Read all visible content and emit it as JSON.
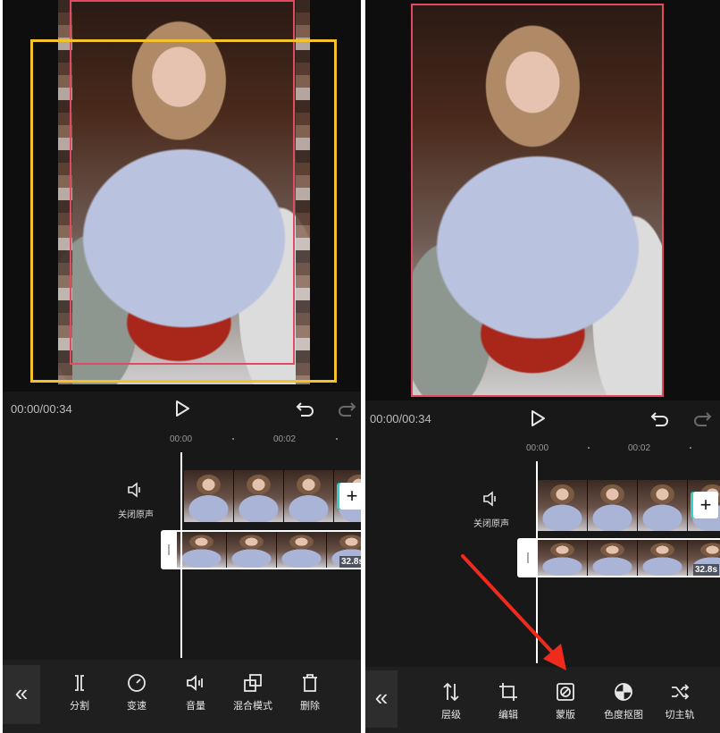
{
  "left": {
    "time": "00:00/00:34",
    "ruler": [
      "00:00",
      "00:02"
    ],
    "mute_label": "关闭原声",
    "duration": "32.8s",
    "tools": [
      {
        "icon": "split-icon",
        "label": "分割"
      },
      {
        "icon": "speed-icon",
        "label": "变速"
      },
      {
        "icon": "volume-icon",
        "label": "音量"
      },
      {
        "icon": "blend-mode-icon",
        "label": "混合模式"
      },
      {
        "icon": "delete-icon",
        "label": "删除"
      }
    ]
  },
  "right": {
    "time": "00:00/00:34",
    "ruler": [
      "00:00",
      "00:02"
    ],
    "mute_label": "关闭原声",
    "duration": "32.8s",
    "tools": [
      {
        "icon": "layer-icon",
        "label": "层级"
      },
      {
        "icon": "crop-icon",
        "label": "编辑"
      },
      {
        "icon": "mask-icon",
        "label": "蒙版"
      },
      {
        "icon": "chroma-key-icon",
        "label": "色度抠图"
      },
      {
        "icon": "switch-main-track-icon",
        "label": "切主轨"
      }
    ]
  },
  "colors": {
    "selection": "#f6c22b",
    "clip_border": "#e04a62",
    "arrow": "#f02a1c",
    "accent": "#36d1c8"
  }
}
